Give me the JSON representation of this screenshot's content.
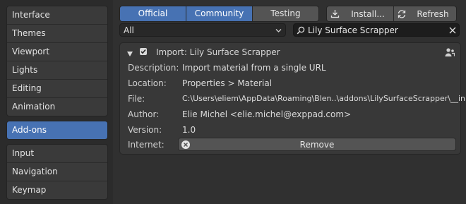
{
  "sidebar": {
    "group1": [
      "Interface",
      "Themes",
      "Viewport",
      "Lights",
      "Editing",
      "Animation"
    ],
    "group2": [
      "Add-ons"
    ],
    "group3": [
      "Input",
      "Navigation",
      "Keymap"
    ],
    "active": "Add-ons"
  },
  "filter_tabs": [
    {
      "label": "Official",
      "active": true
    },
    {
      "label": "Community",
      "active": true
    },
    {
      "label": "Testing",
      "active": false
    }
  ],
  "toolbar": {
    "install_label": "Install...",
    "refresh_label": "Refresh"
  },
  "category_dropdown": {
    "value": "All"
  },
  "search": {
    "value": "Lily Surface Scrapper"
  },
  "addon": {
    "title": "Import: Lily Surface Scrapper",
    "enabled": true,
    "fields": {
      "description_key": "Description:",
      "description": "Import material from a single URL",
      "location_key": "Location:",
      "location": "Properties > Material",
      "file_key": "File:",
      "file": "C:\\Users\\eliem\\AppData\\Roaming\\Blen..\\addons\\LilySurfaceScrapper\\__init__.p",
      "author_key": "Author:",
      "author": "Elie Michel <elie.michel@exppad.com>",
      "version_key": "Version:",
      "version": "1.0",
      "internet_key": "Internet:"
    },
    "remove_label": "Remove"
  },
  "colors": {
    "accent": "#4772b3",
    "background": "#303030",
    "panel": "#383838",
    "button": "#545454"
  }
}
